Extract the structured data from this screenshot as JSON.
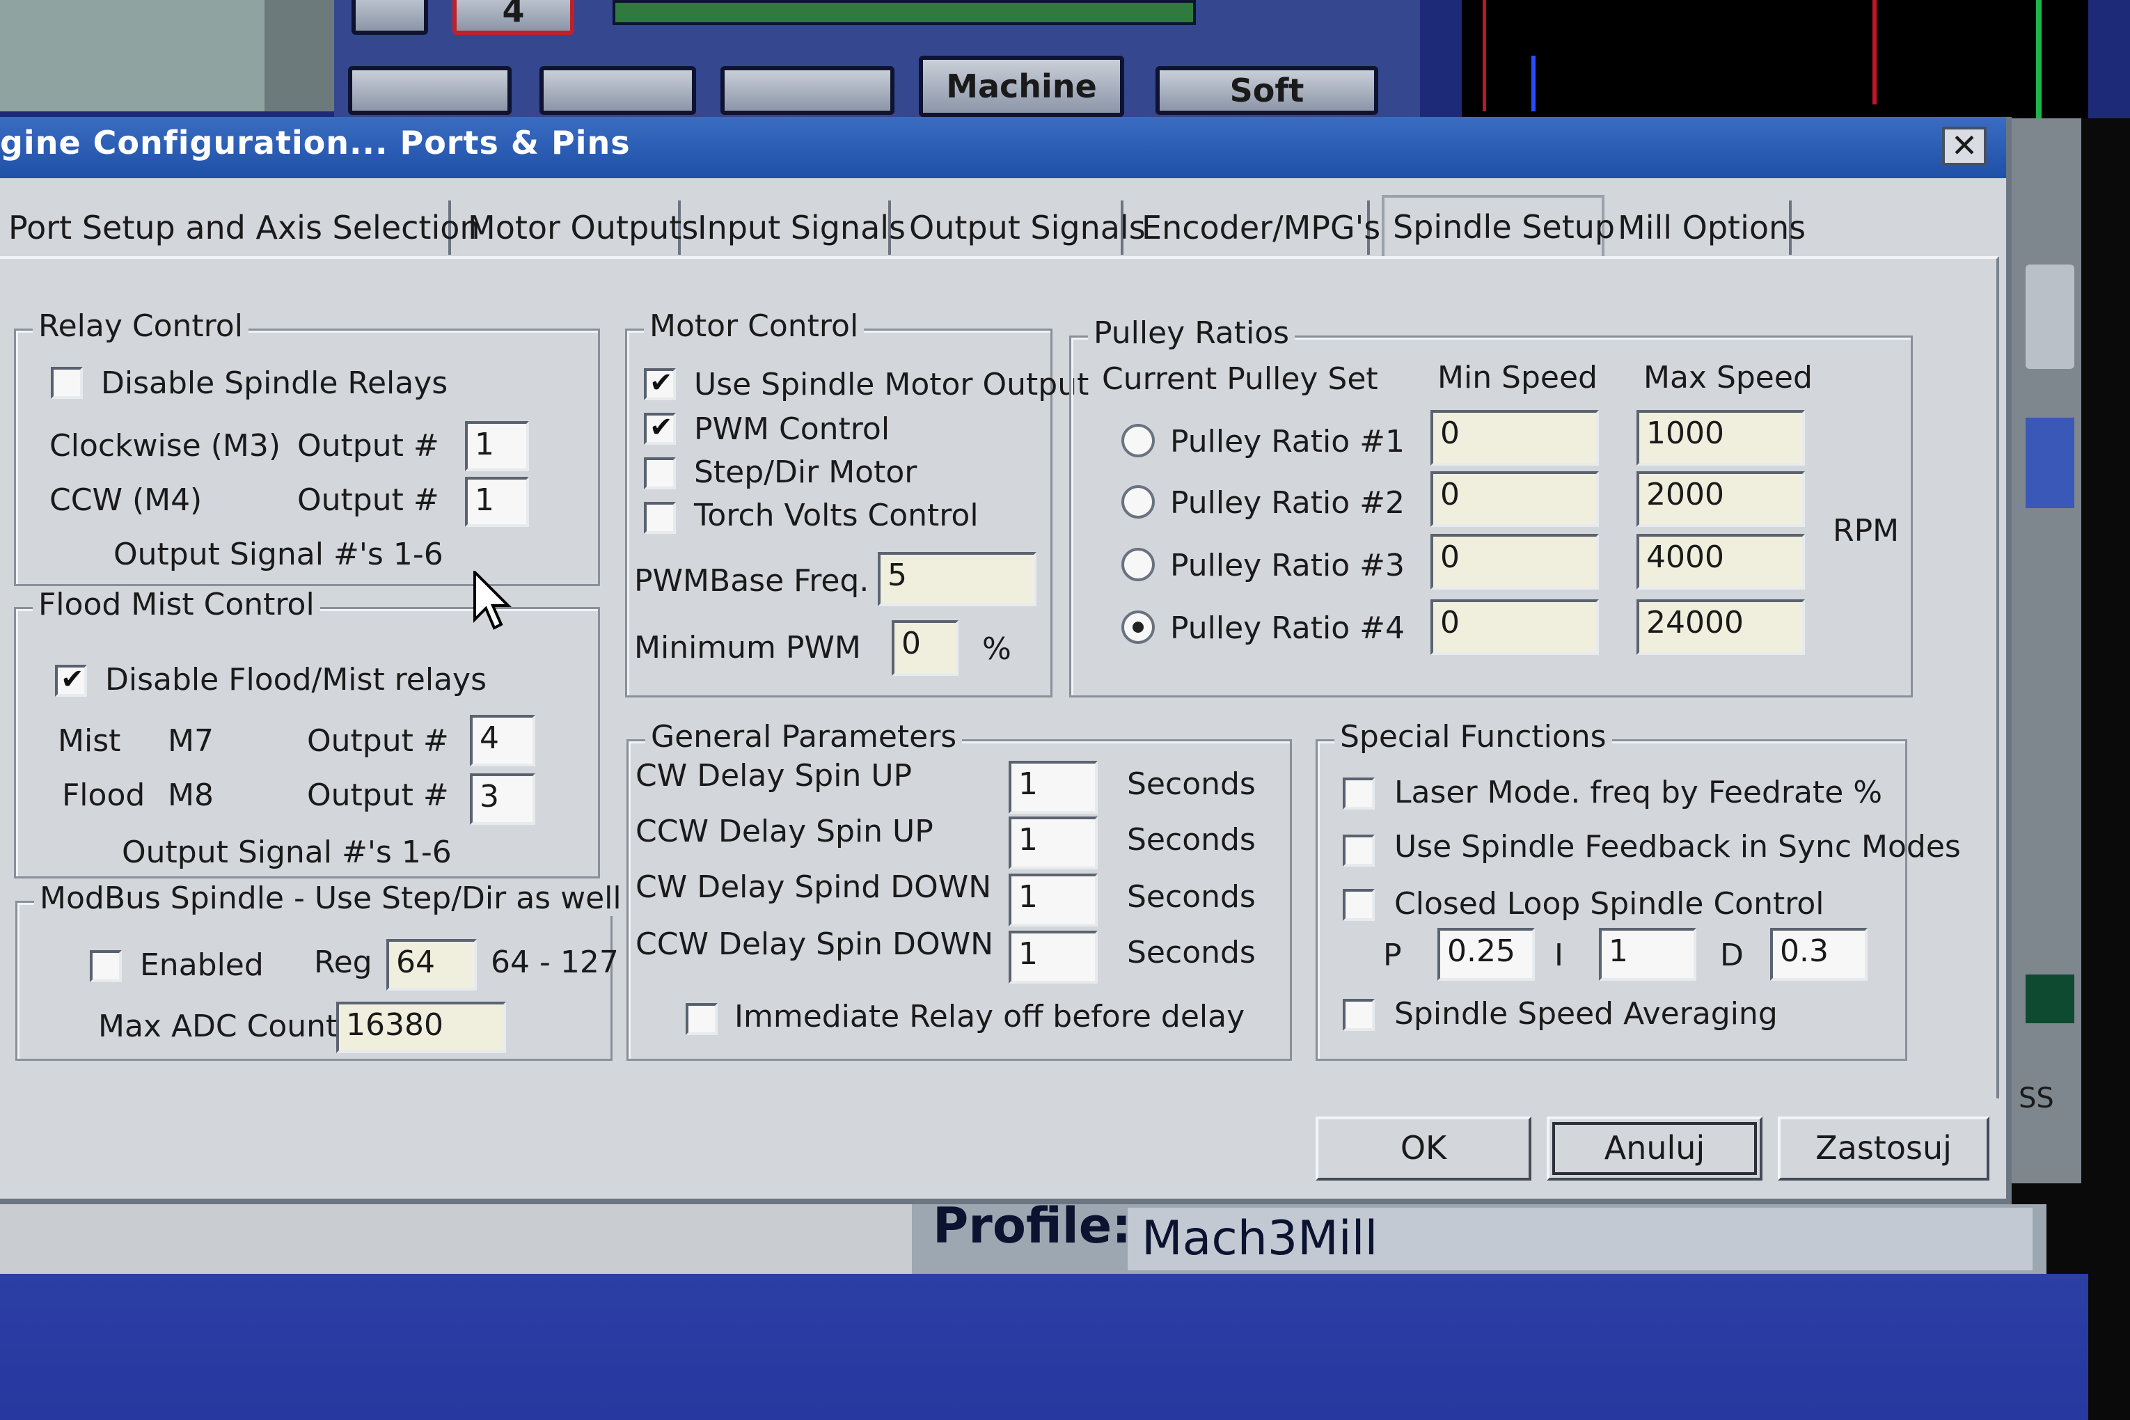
{
  "background": {
    "buttons": [
      "4",
      "Machine",
      "Soft"
    ],
    "profile_label": "Profile:",
    "profile_value": "Mach3Mill",
    "side_text": "SS"
  },
  "dialog": {
    "title": "gine Configuration... Ports & Pins",
    "close": "✕",
    "tabs": [
      "Port Setup and Axis Selection",
      "Motor Outputs",
      "Input Signals",
      "Output Signals",
      "Encoder/MPG's",
      "Spindle Setup",
      "Mill Options"
    ],
    "active_tab": "Spindle Setup",
    "relay_control": {
      "legend": "Relay Control",
      "disable_label": "Disable Spindle Relays",
      "disable_checked": false,
      "cw_label": "Clockwise (M3)",
      "ccw_label": "CCW (M4)",
      "output_label": "Output #",
      "cw_output": "1",
      "ccw_output": "1",
      "signal_note": "Output Signal #'s 1-6"
    },
    "flood_mist": {
      "legend": "Flood Mist Control",
      "disable_label": "Disable Flood/Mist relays",
      "disable_checked": true,
      "mist_label": "Mist",
      "mist_code": "M7",
      "flood_label": "Flood",
      "flood_code": "M8",
      "output_label": "Output #",
      "mist_output": "4",
      "flood_output": "3",
      "signal_note": "Output Signal #'s 1-6"
    },
    "modbus": {
      "legend": "ModBus Spindle - Use Step/Dir as well",
      "enabled_label": "Enabled",
      "enabled_checked": false,
      "reg_label": "Reg",
      "reg_value": "64",
      "reg_range": "64 - 127",
      "max_adc_label": "Max ADC Count",
      "max_adc_value": "16380"
    },
    "motor_control": {
      "legend": "Motor Control",
      "options": [
        {
          "label": "Use Spindle Motor Output",
          "checked": true
        },
        {
          "label": "PWM Control",
          "checked": true
        },
        {
          "label": "Step/Dir Motor",
          "checked": false
        },
        {
          "label": "Torch Volts Control",
          "checked": false
        }
      ],
      "pwm_base_label": "PWMBase Freq.",
      "pwm_base_value": "5",
      "min_pwm_label": "Minimum PWM",
      "min_pwm_value": "0",
      "min_pwm_unit": "%"
    },
    "pulley_ratios": {
      "legend": "Pulley Ratios",
      "current_set_label": "Current Pulley Set",
      "min_header": "Min Speed",
      "max_header": "Max Speed",
      "unit": "RPM",
      "rows": [
        {
          "label": "Pulley Ratio #1",
          "min": "0",
          "max": "1000",
          "selected": false
        },
        {
          "label": "Pulley Ratio #2",
          "min": "0",
          "max": "2000",
          "selected": false
        },
        {
          "label": "Pulley Ratio #3",
          "min": "0",
          "max": "4000",
          "selected": false
        },
        {
          "label": "Pulley Ratio #4",
          "min": "0",
          "max": "24000",
          "selected": true
        }
      ]
    },
    "general_parameters": {
      "legend": "General Parameters",
      "unit": "Seconds",
      "rows": [
        {
          "label": "CW Delay Spin UP",
          "value": "1"
        },
        {
          "label": "CCW Delay Spin UP",
          "value": "1"
        },
        {
          "label": "CW Delay Spind DOWN",
          "value": "1"
        },
        {
          "label": "CCW Delay Spin DOWN",
          "value": "1"
        }
      ],
      "immediate_label": "Immediate Relay off before delay",
      "immediate_checked": false
    },
    "special_functions": {
      "legend": "Special Functions",
      "laser_label": "Laser Mode. freq by Feedrate %",
      "feedback_label": "Use Spindle Feedback in Sync Modes",
      "closed_loop_label": "Closed Loop Spindle Control",
      "averaging_label": "Spindle Speed Averaging",
      "p_label": "P",
      "p_value": "0.25",
      "i_label": "I",
      "i_value": "1",
      "d_label": "D",
      "d_value": "0.3"
    },
    "buttons": {
      "ok": "OK",
      "cancel": "Anuluj",
      "apply": "Zastosuj"
    }
  }
}
